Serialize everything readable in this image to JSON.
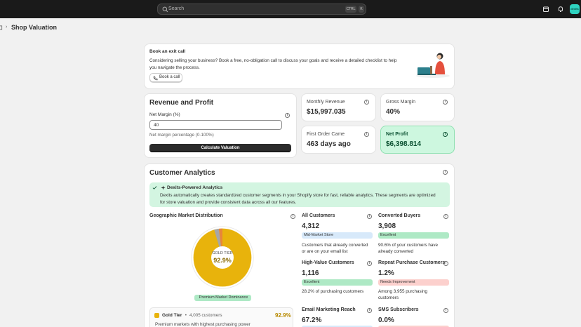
{
  "topbar": {
    "search_placeholder": "Search",
    "shortcut_1": "CTRL",
    "shortcut_2": "K",
    "avatar_text": "dexits"
  },
  "breadcrumb": {
    "title": "Shop Valuation"
  },
  "exit_call": {
    "title": "Book an exit call",
    "body_line1": "Considering selling your business? Book a free, no-obligation call to discuss your goals and receive a detailed checklist to help",
    "body_line2": "you navigate the process.",
    "button": "Book a call"
  },
  "revenue": {
    "title": "Revenue and Profit",
    "field_label": "Net Margin (%)",
    "field_value": "40",
    "help": "Net margin percentage (0-100%)",
    "button": "Calculate Valuation"
  },
  "metrics": {
    "monthly_revenue": {
      "label": "Monthly Revenue",
      "value": "$15,997.035"
    },
    "gross_margin": {
      "label": "Gross Margin",
      "value": "40%"
    },
    "first_order": {
      "label": "First Order Came",
      "value": "463 days ago"
    },
    "net_profit": {
      "label": "Net Profit",
      "value": "$6,398.814"
    }
  },
  "analytics": {
    "title": "Customer Analytics",
    "banner_title": "Dexits-Powered Analytics",
    "banner_line1": "Dexits automatically creates standardized customer segments in your Shopify store for fast, reliable analytics. These segments are optimized",
    "banner_line2": "for store valuation and provide consistent data across all our features.",
    "geo": {
      "title": "Geographic Market Distribution",
      "donut_label": "GOLD TIER",
      "donut_value": "92.9%",
      "donut_percent": 92.9,
      "badge": "Premium Market Dominance",
      "tier_name": "Gold Tier",
      "tier_sep": " • ",
      "tier_customers": "4,005 customers",
      "tier_pct": "92.9%",
      "tier_desc": "Premium markets with highest purchasing power"
    },
    "segments": [
      {
        "title": "All Customers",
        "value": "4,312",
        "badge": "Mid-Market Store",
        "badge_type": "blue",
        "desc_line1": "Customers that already converted",
        "desc_line2": "or are on your email list"
      },
      {
        "title": "Converted Buyers",
        "value": "3,908",
        "badge": "Excellent",
        "badge_type": "green",
        "desc_line1": "90.6% of your customers have",
        "desc_line2": "already converted"
      },
      {
        "title": "High-Value Customers",
        "value": "1,116",
        "badge": "Excellent",
        "badge_type": "green",
        "desc_line1": "28.2% of purchasing customers",
        "desc_line2": ""
      },
      {
        "title": "Repeat Purchase Customers",
        "value": "1.2%",
        "badge": "Needs Improvement",
        "badge_type": "red",
        "desc_line1": "Among 3,955 purchasing",
        "desc_line2": "customers"
      },
      {
        "title": "Email Marketing Reach",
        "value": "67.2%",
        "badge": "",
        "badge_type": "blue",
        "desc_line1": "",
        "desc_line2": ""
      },
      {
        "title": "SMS Subscribers",
        "value": "0.0%",
        "badge": "",
        "badge_type": "red",
        "desc_line1": "",
        "desc_line2": ""
      }
    ]
  },
  "colors": {
    "topbar": "#1a1a1a",
    "gold": "#e8b30c",
    "green_card": "#cdf7df",
    "banner": "#d3f5e1"
  }
}
